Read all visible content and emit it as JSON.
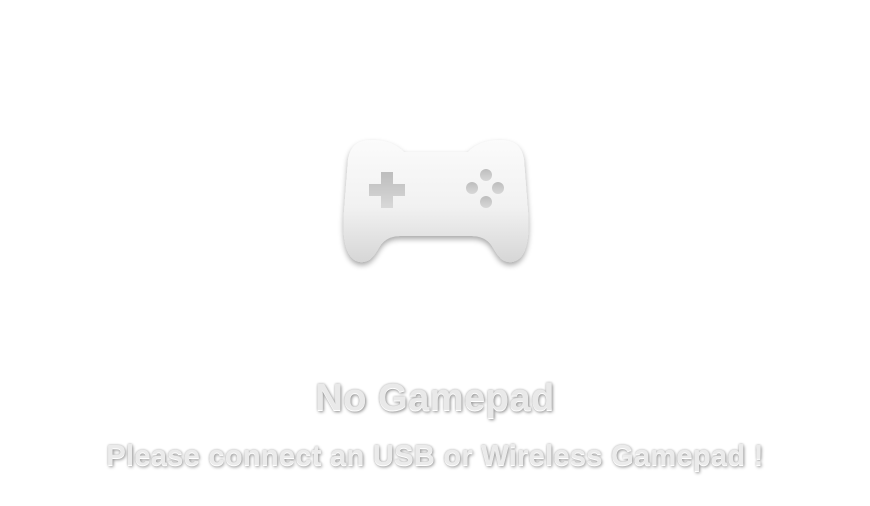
{
  "empty_state": {
    "icon": "gamepad-icon",
    "title": "No Gamepad",
    "message": "Please connect an USB or Wireless Gamepad !"
  },
  "colors": {
    "background": "#ffffff",
    "icon_top": "#fafafa",
    "icon_bottom": "#d9d9d9",
    "text": "#ebebeb"
  }
}
